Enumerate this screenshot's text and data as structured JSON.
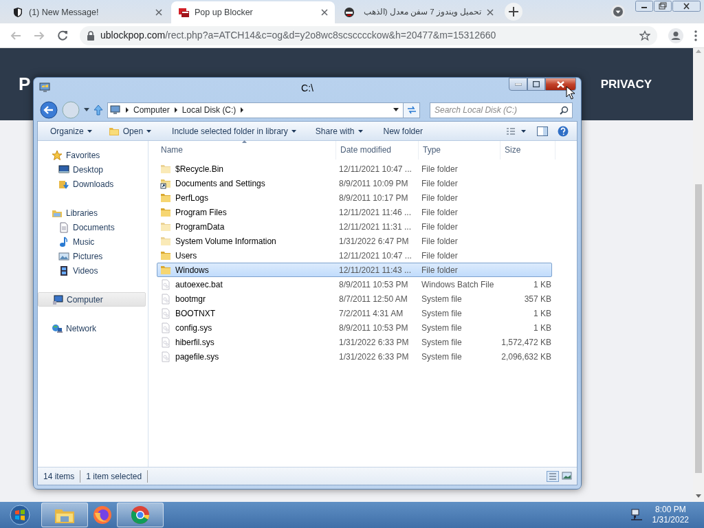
{
  "browser": {
    "tabs": [
      {
        "title": "(1) New Message!",
        "selected": false
      },
      {
        "title": "Pop up Blocker",
        "selected": true
      },
      {
        "title": "تحميل ويندوز 7 سفن معدل (الذهب",
        "selected": false
      }
    ],
    "url_host": "ublockpop.com",
    "url_path": "/rect.php?a=ATCH14&c=og&d=y2o8wc8scscccckow&h=20477&m=15312660"
  },
  "page": {
    "brand": "P",
    "nav_link": "PRIVACY"
  },
  "explorer": {
    "title": "C:\\",
    "breadcrumb": [
      "Computer",
      "Local Disk (C:)"
    ],
    "search": {
      "placeholder": "Search Local Disk (C:)"
    },
    "toolbar": [
      {
        "label": "Organize",
        "dropdown": true
      },
      {
        "label": "Open",
        "dropdown": true
      },
      {
        "label": "Include selected folder in library",
        "dropdown": true
      },
      {
        "label": "Share with",
        "dropdown": true
      },
      {
        "label": "New folder",
        "dropdown": false
      }
    ],
    "navigation": [
      {
        "label": "Favorites",
        "selected": false,
        "children": [
          {
            "label": "Desktop",
            "selected": false
          },
          {
            "label": "Downloads",
            "selected": false
          }
        ]
      },
      {
        "label": "Libraries",
        "selected": false,
        "children": [
          {
            "label": "Documents",
            "selected": false
          },
          {
            "label": "Music",
            "selected": false
          },
          {
            "label": "Pictures",
            "selected": false
          },
          {
            "label": "Videos",
            "selected": false
          }
        ]
      },
      {
        "label": "Computer",
        "selected": true
      },
      {
        "label": "Network",
        "selected": false
      }
    ],
    "columns": [
      {
        "label": "Name",
        "sorted": true
      },
      {
        "label": "Date modified",
        "sorted": false
      },
      {
        "label": "Type",
        "sorted": false
      },
      {
        "label": "Size",
        "sorted": false
      }
    ],
    "rows": [
      {
        "kind": "folder",
        "name": "$Recycle.Bin",
        "date": "12/11/2021 10:47 ...",
        "type": "File folder",
        "hidden": true,
        "selected": false
      },
      {
        "kind": "shortcut",
        "name": "Documents and Settings",
        "date": "8/9/2011 10:09 PM",
        "type": "File folder",
        "hidden": false,
        "selected": false
      },
      {
        "kind": "folder",
        "name": "PerfLogs",
        "date": "8/9/2011 10:17 PM",
        "type": "File folder",
        "hidden": false,
        "selected": false
      },
      {
        "kind": "folder",
        "name": "Program Files",
        "date": "12/11/2021 11:46 ...",
        "type": "File folder",
        "hidden": false,
        "selected": false
      },
      {
        "kind": "folder",
        "name": "ProgramData",
        "date": "12/11/2021 11:31 ...",
        "type": "File folder",
        "hidden": true,
        "selected": false
      },
      {
        "kind": "folder",
        "name": "System Volume Information",
        "date": "1/31/2022 6:47 PM",
        "type": "File folder",
        "hidden": true,
        "selected": false
      },
      {
        "kind": "folder",
        "name": "Users",
        "date": "12/11/2021 10:47 ...",
        "type": "File folder",
        "hidden": false,
        "selected": false
      },
      {
        "kind": "folder",
        "name": "Windows",
        "date": "12/11/2021 11:43 ...",
        "type": "File folder",
        "hidden": false,
        "selected": true
      },
      {
        "kind": "file",
        "name": "autoexec.bat",
        "date": "8/9/2011 10:53 PM",
        "type": "Windows Batch File",
        "size": "1 KB",
        "hidden": true,
        "selected": false
      },
      {
        "kind": "file",
        "name": "bootmgr",
        "date": "8/7/2011 12:50 AM",
        "type": "System file",
        "size": "357 KB",
        "hidden": true,
        "selected": false
      },
      {
        "kind": "file",
        "name": "BOOTNXT",
        "date": "7/2/2011 4:31 AM",
        "type": "System file",
        "size": "1 KB",
        "hidden": true,
        "selected": false
      },
      {
        "kind": "file",
        "name": "config.sys",
        "date": "8/9/2011 10:53 PM",
        "type": "System file",
        "size": "1 KB",
        "hidden": true,
        "selected": false
      },
      {
        "kind": "file",
        "name": "hiberfil.sys",
        "date": "1/31/2022 6:33 PM",
        "type": "System file",
        "size": "1,572,472 KB",
        "hidden": true,
        "selected": false
      },
      {
        "kind": "file",
        "name": "pagefile.sys",
        "date": "1/31/2022 6:33 PM",
        "type": "System file",
        "size": "2,096,632 KB",
        "hidden": true,
        "selected": false
      }
    ],
    "status": [
      "14 items",
      "1 item selected"
    ]
  },
  "taskbar": {
    "buttons": [
      {
        "kind": "explorer",
        "active": true
      },
      {
        "kind": "firefox",
        "active": false
      },
      {
        "kind": "chrome",
        "active": true
      }
    ],
    "time": "8:00 PM",
    "date": "1/31/2022"
  }
}
